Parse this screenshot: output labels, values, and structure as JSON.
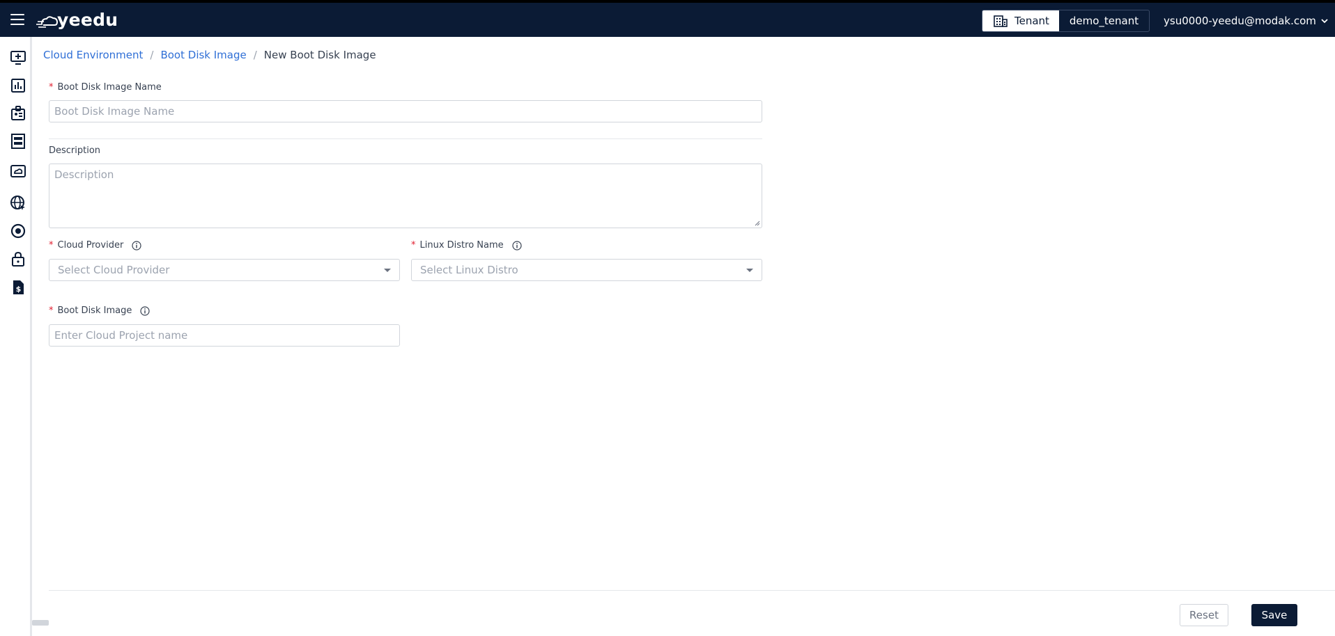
{
  "app": {
    "logo_text": "yeedu"
  },
  "header": {
    "tenant_label": "Tenant",
    "tenant_value": "demo_tenant",
    "user_email": "ysu0000-yeedu@modak.com"
  },
  "sidebar": {
    "items": [
      {
        "icon": "monitor-add-icon"
      },
      {
        "icon": "bar-chart-icon"
      },
      {
        "icon": "id-badge-icon"
      },
      {
        "icon": "building-icon"
      },
      {
        "icon": "cloud-drive-icon"
      },
      {
        "icon": "globe-cursor-icon"
      },
      {
        "icon": "disc-icon"
      },
      {
        "icon": "lock-icon"
      },
      {
        "icon": "billing-document-icon"
      }
    ]
  },
  "breadcrumb": {
    "items": [
      "Cloud Environment",
      "Boot Disk Image"
    ],
    "current": "New Boot Disk Image",
    "separator": "/"
  },
  "form": {
    "name_label": "Boot Disk Image Name",
    "name_placeholder": "Boot Disk Image Name",
    "description_label": "Description",
    "description_placeholder": "Description",
    "cloud_provider_label": "Cloud Provider",
    "cloud_provider_placeholder": "Select Cloud Provider",
    "linux_distro_label": "Linux Distro Name",
    "linux_distro_placeholder": "Select Linux Distro",
    "boot_disk_image_label": "Boot Disk Image",
    "boot_disk_image_placeholder": "Enter Cloud Project name",
    "required_mark": "*"
  },
  "actions": {
    "reset_label": "Reset",
    "save_label": "Save"
  },
  "colors": {
    "header_bg": "#0b1b35",
    "link": "#2f6fd6",
    "required": "#e11d2e",
    "primary_button": "#0b1b35"
  }
}
